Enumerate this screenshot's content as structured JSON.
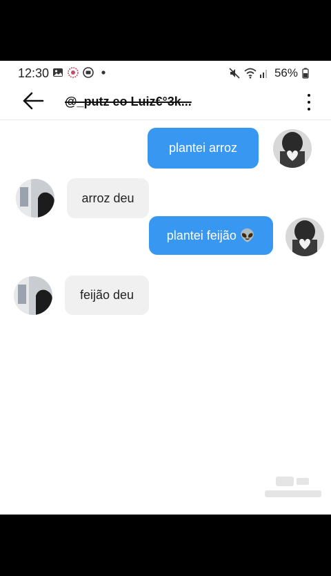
{
  "status_bar": {
    "time": "12:30",
    "left_icons": [
      "image-icon",
      "flower-icon",
      "record-icon",
      "dot-icon"
    ],
    "right_icons": [
      "mute-icon",
      "wifi-icon",
      "signal-icon",
      "battery-icon"
    ],
    "battery": "56%"
  },
  "header": {
    "title": "@_putz eo Luiz€°3k...",
    "back_icon": "back-arrow-icon",
    "menu_icon": "more-vertical-icon"
  },
  "messages": [
    {
      "direction": "sent",
      "text": "plantei arroz",
      "avatar": "heart-hands-avatar"
    },
    {
      "direction": "received",
      "text": "arroz deu",
      "avatar": "contact-avatar"
    },
    {
      "direction": "sent",
      "text": "plantei feijão 👽",
      "avatar": "heart-hands-avatar"
    },
    {
      "direction": "received",
      "text": "feijão deu",
      "avatar": "contact-avatar"
    }
  ],
  "colors": {
    "sent_bubble": "#3897f0",
    "received_bubble": "#f0f0f0",
    "background": "#ffffff"
  }
}
